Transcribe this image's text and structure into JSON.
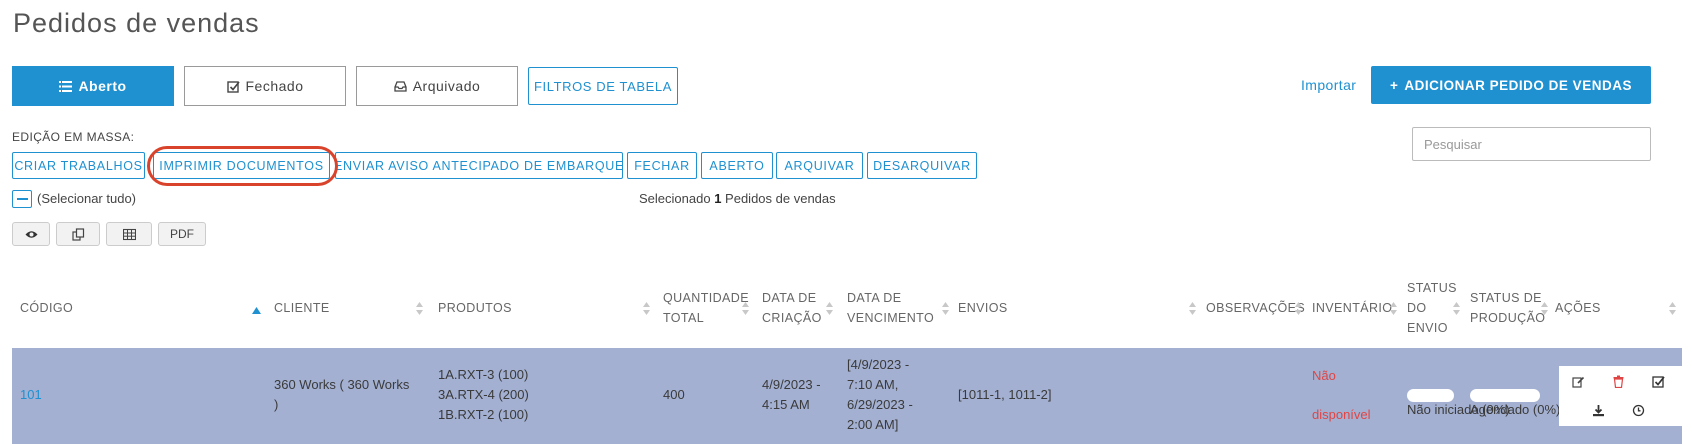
{
  "page": {
    "title": "Pedidos de vendas"
  },
  "tabs": [
    {
      "label": "Aberto",
      "icon": "list-icon",
      "active": true
    },
    {
      "label": "Fechado",
      "icon": "check-square-icon",
      "active": false
    },
    {
      "label": "Arquivado",
      "icon": "inbox-icon",
      "active": false
    }
  ],
  "toolbar": {
    "filters_label": "FILTROS DE TABELA",
    "import_label": "Importar",
    "add_label": "ADICIONAR PEDIDO DE VENDAS"
  },
  "bulk": {
    "label": "EDIÇÃO EM MASSA:",
    "buttons": [
      "CRIAR TRABALHOS",
      "IMPRIMIR DOCUMENTOS",
      "ENVIAR AVISO ANTECIPADO DE EMBARQUE",
      "FECHAR",
      "ABERTO",
      "ARQUIVAR",
      "DESARQUIVAR"
    ],
    "highlighted_button": "IMPRIMIR DOCUMENTOS"
  },
  "search": {
    "placeholder": "Pesquisar"
  },
  "selection": {
    "select_all_label": "(Selecionar tudo)",
    "prefix": "Selecionado",
    "count": "1",
    "suffix": "Pedidos de vendas"
  },
  "view_buttons": {
    "eye_icon": "eye-icon",
    "copy_icon": "copy-icon",
    "table_icon": "table-icon",
    "pdf_label": "PDF"
  },
  "table": {
    "columns": {
      "codigo": "CÓDIGO",
      "cliente": "CLIENTE",
      "produtos": "PRODUTOS",
      "quantidade_1": "QUANTIDADE",
      "quantidade_2": "TOTAL",
      "criacao_1": "DATA DE",
      "criacao_2": "CRIAÇÃO",
      "vencimento_1": "DATA DE",
      "vencimento_2": "VENCIMENTO",
      "envios": "ENVIOS",
      "observacoes": "OBSERVAÇÕES",
      "inventario": "INVENTÁRIO",
      "status_envio_1": "STATUS",
      "status_envio_2": "DO",
      "status_envio_3": "ENVIO",
      "status_producao_1": "STATUS DE",
      "status_producao_2": "PRODUÇÃO",
      "acoes": "AÇÕES"
    },
    "sort_column": "CÓDIGO",
    "rows": [
      {
        "codigo": "101",
        "cliente_1": "360 Works ( 360 Works",
        "cliente_2": ")",
        "produtos": [
          "1A.RXT-3 (100)",
          "3A.RTX-4 (200)",
          "1B.RXT-2 (100)"
        ],
        "quantidade": "400",
        "criacao_1": "4/9/2023 -",
        "criacao_2": "4:15 AM",
        "vencimento": [
          "[4/9/2023 -",
          "7:10 AM,",
          "6/29/2023 -",
          "2:00 AM]"
        ],
        "envios": "[1011-1, 1011-2]",
        "inventario_1": "Não",
        "inventario_2": "disponível",
        "status_envio": "Não iniciado (0%)",
        "status_producao": "Agendado (0%)"
      }
    ]
  },
  "colors": {
    "accent": "#1f91d0",
    "row_selected": "#a3b0d1",
    "warning": "#e04545",
    "highlight_ring": "#d9432b"
  }
}
